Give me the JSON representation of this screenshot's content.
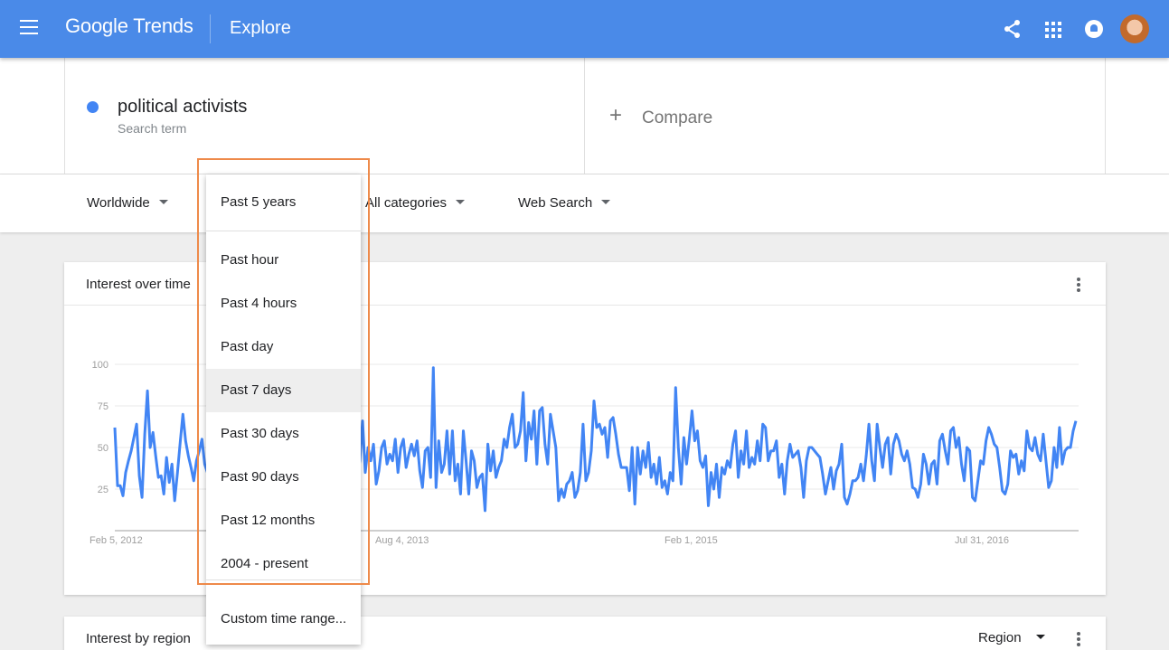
{
  "header": {
    "brand": "Google Trends",
    "page_title": "Explore"
  },
  "search": {
    "term": "political activists",
    "term_type": "Search term",
    "term_color": "#4285f4",
    "compare_label": "Compare"
  },
  "filters": {
    "location": "Worldwide",
    "time": "Past 5 years",
    "category": "All categories",
    "search_type": "Web Search"
  },
  "time_menu": {
    "selected": "Past 5 years",
    "options": [
      "Past hour",
      "Past 4 hours",
      "Past day",
      "Past 7 days",
      "Past 30 days",
      "Past 90 days",
      "Past 12 months",
      "2004 - present"
    ],
    "hovered": "Past 7 days",
    "custom": "Custom time range..."
  },
  "interest_over_time": {
    "title": "Interest over time"
  },
  "interest_by_region": {
    "title": "Interest by region",
    "resolution": "Region"
  },
  "colors": {
    "topbar": "#4a8ae8",
    "series": "#4285f4",
    "highlight": "#ee8a4a"
  },
  "chart_data": {
    "type": "line",
    "title": "Interest over time",
    "xlabel": "",
    "ylabel": "",
    "ylim": [
      0,
      100
    ],
    "yticks": [
      25,
      50,
      75,
      100
    ],
    "xtick_labels": [
      "Feb 5, 2012",
      "Aug 4, 2013",
      "Feb 1, 2015",
      "Jul 31, 2016"
    ],
    "x": [
      "2012-02-05",
      "2017-01-29"
    ],
    "series": [
      {
        "color": "#4285f4",
        "values": [
          62,
          27,
          27,
          21,
          35,
          42,
          48,
          56,
          64,
          33,
          20,
          58,
          84,
          50,
          59,
          45,
          32,
          33,
          22,
          44,
          29,
          40,
          18,
          35,
          53,
          70,
          54,
          45,
          38,
          30,
          42,
          48,
          55,
          40,
          35,
          60,
          45,
          40,
          45,
          38,
          22,
          30,
          28,
          36,
          44,
          25,
          40,
          34,
          48,
          54,
          25,
          38,
          40,
          30,
          48,
          30,
          44,
          38,
          35,
          48,
          40,
          30,
          36,
          32,
          40,
          38,
          43,
          30,
          48,
          40,
          20,
          44,
          38,
          40,
          34,
          38,
          20,
          34,
          40,
          24,
          36,
          48,
          40,
          50,
          44,
          20,
          38,
          48,
          60,
          32,
          42,
          66,
          35,
          50,
          42,
          52,
          28,
          36,
          50,
          54,
          40,
          46,
          42,
          55,
          35,
          50,
          55,
          38,
          46,
          52,
          45,
          54,
          36,
          26,
          48,
          50,
          32,
          98,
          26,
          54,
          35,
          40,
          60,
          34,
          60,
          30,
          40,
          22,
          60,
          42,
          22,
          48,
          42,
          26,
          32,
          34,
          12,
          52,
          36,
          48,
          32,
          38,
          42,
          55,
          50,
          62,
          70,
          50,
          52,
          60,
          83,
          42,
          65,
          55,
          72,
          40,
          72,
          74,
          52,
          40,
          70,
          60,
          50,
          18,
          25,
          20,
          28,
          30,
          35,
          20,
          24,
          35,
          64,
          30,
          35,
          48,
          78,
          62,
          64,
          58,
          62,
          44,
          66,
          68,
          58,
          46,
          38,
          38,
          38,
          24,
          50,
          16,
          50,
          34,
          48,
          38,
          53,
          32,
          40,
          28,
          44,
          26,
          30,
          22,
          35,
          30,
          86,
          50,
          28,
          56,
          40,
          55,
          72,
          54,
          60,
          42,
          38,
          45,
          15,
          35,
          25,
          40,
          20,
          38,
          34,
          42,
          38,
          52,
          60,
          32,
          48,
          40,
          60,
          38,
          44,
          40,
          54,
          42,
          64,
          62,
          42,
          48,
          48,
          54,
          32,
          40,
          22,
          42,
          52,
          44,
          46,
          48,
          38,
          20,
          42,
          50,
          50,
          48,
          46,
          44,
          34,
          22,
          30,
          38,
          25,
          36,
          40,
          52,
          20,
          16,
          22,
          30,
          30,
          32,
          40,
          30,
          45,
          64,
          42,
          30,
          64,
          50,
          38,
          52,
          56,
          34,
          52,
          58,
          54,
          46,
          42,
          48,
          40,
          26,
          25,
          20,
          28,
          46,
          40,
          28,
          40,
          42,
          28,
          54,
          58,
          48,
          40,
          60,
          62,
          50,
          56,
          40,
          30,
          50,
          48,
          20,
          18,
          30,
          42,
          40,
          54,
          62,
          58,
          52,
          50,
          38,
          24,
          22,
          28,
          48,
          44,
          46,
          34,
          42,
          36,
          60,
          50,
          48,
          56,
          46,
          42,
          58,
          42,
          26,
          30,
          50,
          38,
          62,
          40,
          48,
          50,
          50,
          60,
          66
        ]
      }
    ]
  }
}
